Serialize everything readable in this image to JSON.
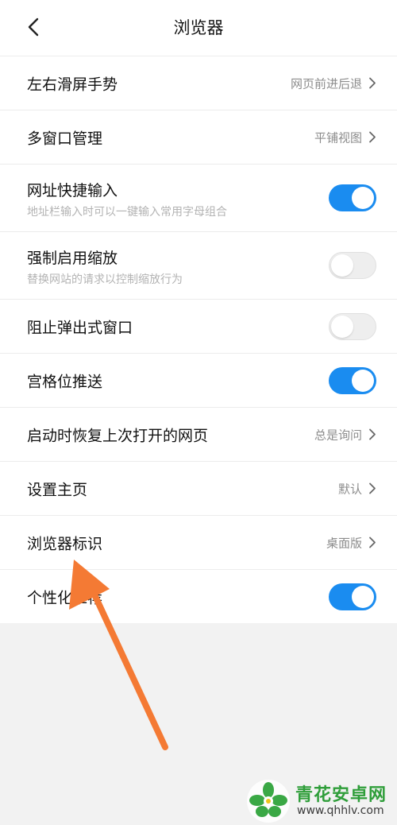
{
  "header": {
    "title": "浏览器"
  },
  "settings": [
    {
      "label": "左右滑屏手势",
      "value": "网页前进后退",
      "kind": "link"
    },
    {
      "label": "多窗口管理",
      "value": "平铺视图",
      "kind": "link"
    },
    {
      "label": "网址快捷输入",
      "desc": "地址栏输入时可以一键输入常用字母组合",
      "kind": "toggle",
      "on": true
    },
    {
      "label": "强制启用缩放",
      "desc": "替换网站的请求以控制缩放行为",
      "kind": "toggle",
      "on": false
    },
    {
      "label": "阻止弹出式窗口",
      "kind": "toggle",
      "on": false
    },
    {
      "label": "宫格位推送",
      "kind": "toggle",
      "on": true
    },
    {
      "label": "启动时恢复上次打开的网页",
      "value": "总是询问",
      "kind": "link"
    },
    {
      "label": "设置主页",
      "value": "默认",
      "kind": "link"
    },
    {
      "label": "浏览器标识",
      "value": "桌面版",
      "kind": "link"
    },
    {
      "label": "个性化推荐",
      "kind": "toggle",
      "on": true
    }
  ],
  "watermark": {
    "title": "青花安卓网",
    "url": "www.qhhlv.com"
  },
  "colors": {
    "accent": "#1a8cf0",
    "arrow": "#f47a34",
    "watermark_green": "#2f9e3a"
  }
}
